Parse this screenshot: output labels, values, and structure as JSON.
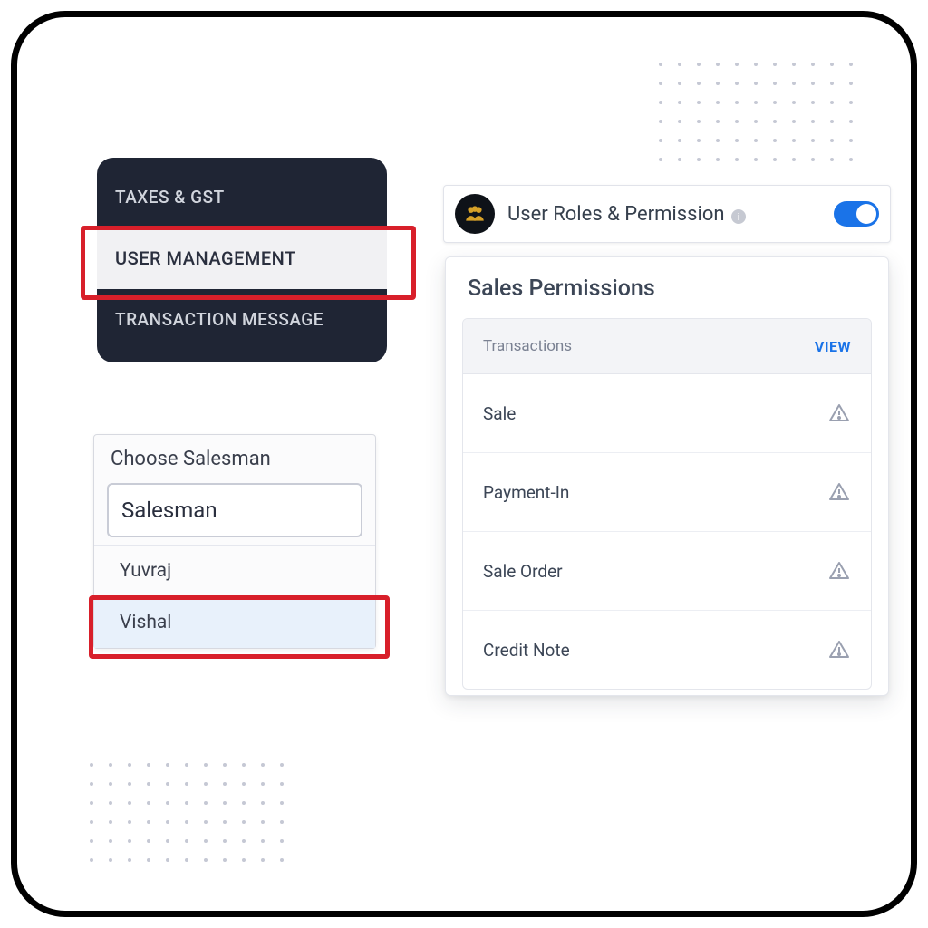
{
  "nav": {
    "items": [
      {
        "label": "TAXES & GST"
      },
      {
        "label": "USER MANAGEMENT",
        "active": true
      },
      {
        "label": "TRANSACTION MESSAGE"
      }
    ]
  },
  "salesman": {
    "title": "Choose Salesman",
    "selected": "Salesman",
    "options": [
      {
        "label": "Yuvraj"
      },
      {
        "label": "Vishal",
        "highlighted": true
      }
    ]
  },
  "roles": {
    "icon": "users-icon",
    "title": "User Roles & Permission",
    "toggle_on": true
  },
  "permissions": {
    "title": "Sales Permissions",
    "header": {
      "col1": "Transactions",
      "col2": "VIEW"
    },
    "rows": [
      {
        "label": "Sale"
      },
      {
        "label": "Payment-In"
      },
      {
        "label": "Sale Order"
      },
      {
        "label": "Credit Note"
      }
    ]
  }
}
